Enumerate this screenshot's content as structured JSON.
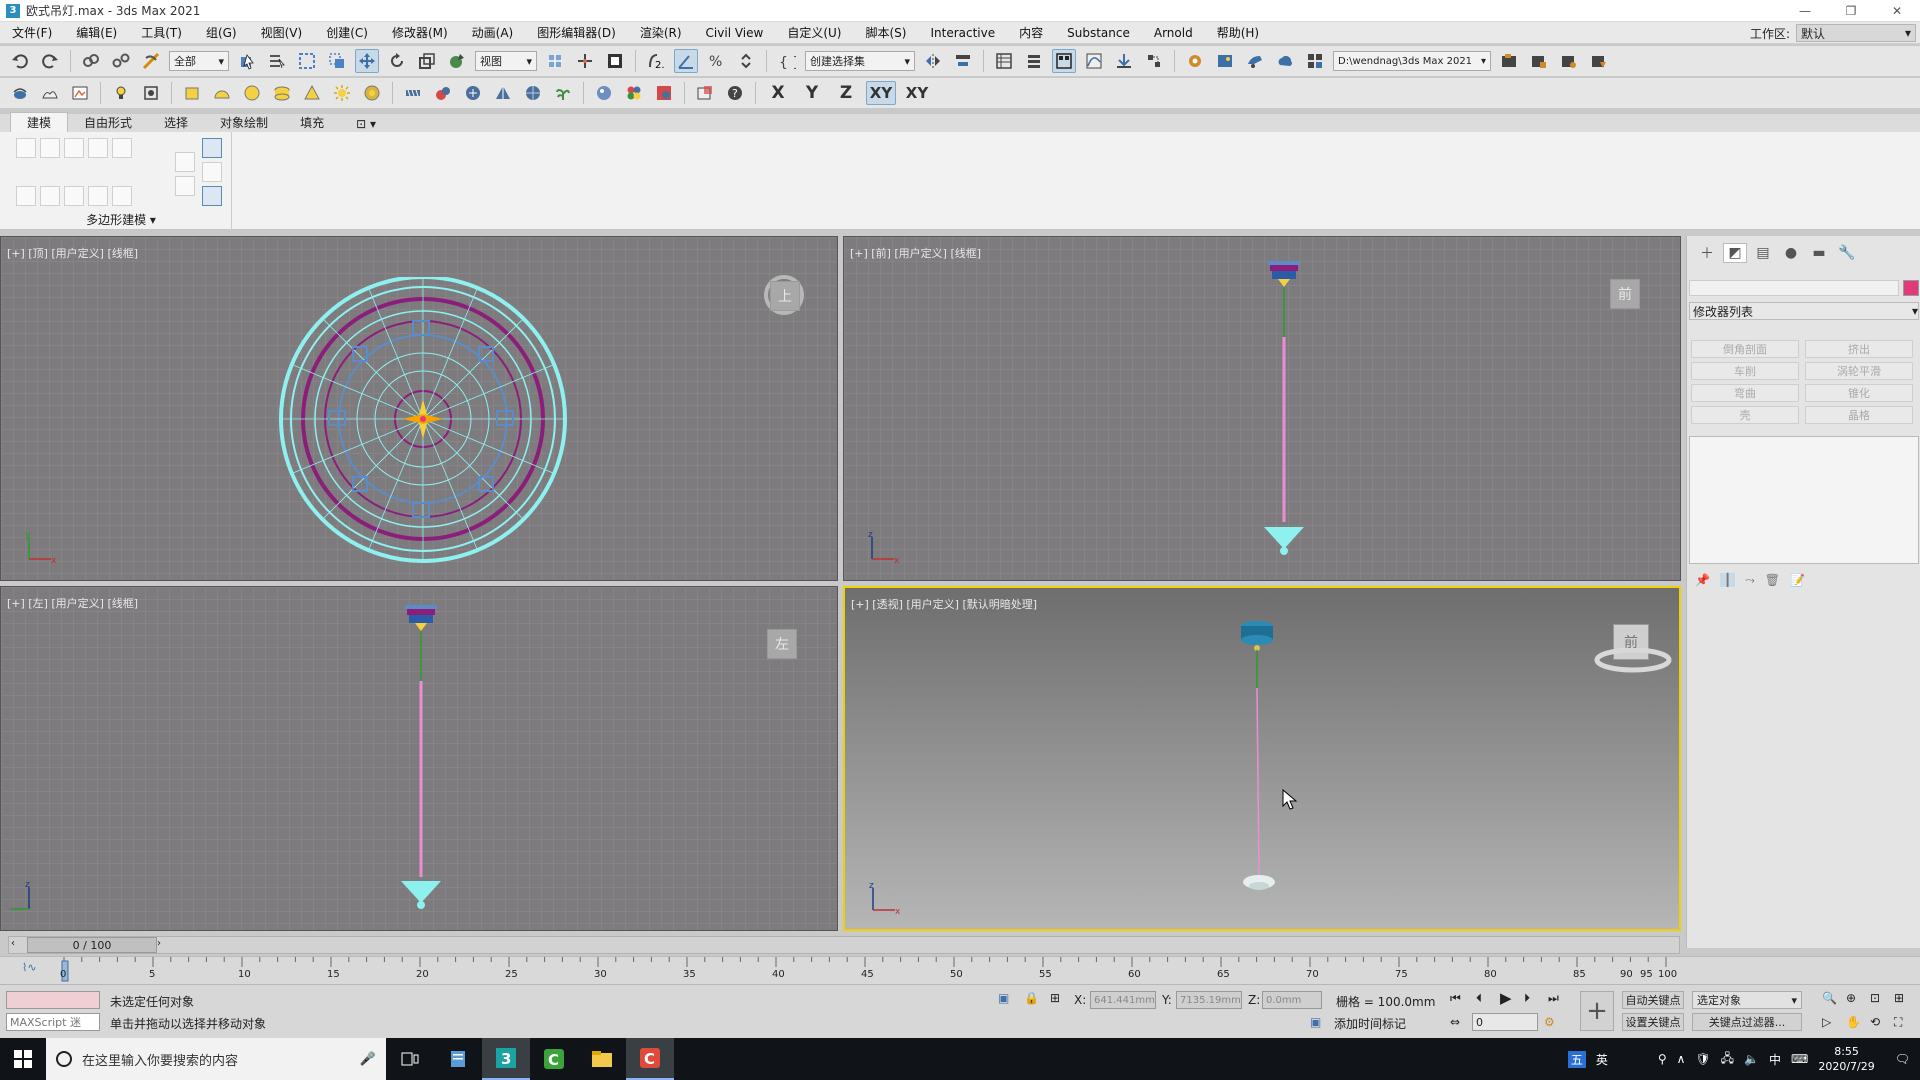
{
  "window": {
    "title": "欧式吊灯.max - 3ds Max 2021",
    "app_icon": "3"
  },
  "menu": {
    "items": [
      "文件(F)",
      "编辑(E)",
      "工具(T)",
      "组(G)",
      "视图(V)",
      "创建(C)",
      "修改器(M)",
      "动画(A)",
      "图形编辑器(D)",
      "渲染(R)",
      "Civil View",
      "自定义(U)",
      "脚本(S)",
      "Interactive",
      "内容",
      "Substance",
      "Arnold",
      "帮助(H)"
    ],
    "workspace_label": "工作区:",
    "workspace_value": "默认"
  },
  "toolbar1": {
    "filter_select": "全部",
    "refcoord_select": "视图",
    "selection_set": "创建选择集",
    "project_path": "D:\\wendnag\\3ds Max 2021"
  },
  "toolbar2": {
    "axis_x": "X",
    "axis_y": "Y",
    "axis_z": "Z",
    "axis_xy": "XY",
    "axis_xy2": "XY"
  },
  "ribbon": {
    "tabs": [
      "建模",
      "自由形式",
      "选择",
      "对象绘制",
      "填充"
    ],
    "active_tab": "建模",
    "panel_label": "多边形建模"
  },
  "viewports": {
    "top": {
      "label": "[+] [顶] [用户定义] [线框]",
      "cube": "上"
    },
    "front": {
      "label": "[+] [前] [用户定义] [线框]",
      "cube": "前"
    },
    "left": {
      "label": "[+] [左] [用户定义] [线框]",
      "cube": "左"
    },
    "persp": {
      "label": "[+] [透视] [用户定义] [默认明暗处理]",
      "cube": "前"
    }
  },
  "command_panel": {
    "modifier_list": "修改器列表",
    "buttons": [
      "倒角剖面",
      "挤出",
      "车削",
      "涡轮平滑",
      "弯曲",
      "锥化",
      "壳",
      "晶格"
    ]
  },
  "timeline": {
    "frame_display": "0 / 100",
    "ticks": [
      "0",
      "5",
      "10",
      "15",
      "20",
      "25",
      "30",
      "35",
      "40",
      "45",
      "50",
      "55",
      "60",
      "65",
      "70",
      "75",
      "80",
      "85",
      "90",
      "95",
      "100"
    ]
  },
  "status": {
    "maxscript": "MAXScript 迷",
    "prompt1": "未选定任何对象",
    "prompt2": "单击并拖动以选择并移动对象",
    "x_label": "X:",
    "x_value": "641.441mm",
    "y_label": "Y:",
    "y_value": "7135.19mm",
    "z_label": "Z:",
    "z_value": "0.0mm",
    "grid": "栅格 = 100.0mm",
    "add_time_tag": "添加时间标记",
    "auto_key": "自动关键点",
    "set_key": "设置关键点",
    "selected_object": "选定对象",
    "key_filters": "关键点过滤器...",
    "frame_field": "0"
  },
  "taskbar": {
    "search_placeholder": "在这里输入你要搜索的内容",
    "ime1": "英",
    "ime2": "中",
    "time": "8:55",
    "date": "2020/7/29"
  },
  "colors": {
    "active_viewport_border": "#f0d000",
    "selection_color_swatch": "#e03a7b",
    "ring_cyan": "#8ff0f0",
    "ring_purple": "#8a1e7a"
  }
}
